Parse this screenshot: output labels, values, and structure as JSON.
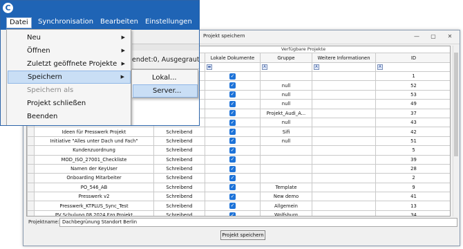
{
  "app": {
    "logo_letter": "C",
    "menu": [
      "Datei",
      "Synchronisation",
      "Bearbeiten",
      "Einstellungen"
    ],
    "status_fragment": "endet:0, Ausgegraut"
  },
  "file_menu": {
    "items": [
      {
        "label": "Neu",
        "submenu": true
      },
      {
        "label": "Öffnen",
        "submenu": true
      },
      {
        "label": "Zuletzt geöffnete Projekte",
        "submenu": true
      },
      {
        "label": "Speichern",
        "submenu": true,
        "highlighted": true
      },
      {
        "label": "Speichern als",
        "disabled": true
      },
      {
        "label": "Projekt schließen"
      },
      {
        "label": "Beenden"
      }
    ],
    "save_submenu": [
      "Lokal...",
      "Server..."
    ],
    "arrow": "▶"
  },
  "dialog": {
    "title": "Projekt speichern",
    "window_buttons": [
      "—",
      "▢",
      "✕"
    ],
    "grid_caption": "Verfügbare Projekte",
    "columns": [
      "",
      "Lokale Dokumente",
      "Gruppe",
      "Weitere Informationen",
      "ID"
    ],
    "rows": [
      {
        "name": "",
        "mode": "",
        "local": true,
        "group": "",
        "info": "",
        "id": "1"
      },
      {
        "name": "",
        "mode": "",
        "local": true,
        "group": "null",
        "info": "",
        "id": "52"
      },
      {
        "name": "",
        "mode": "",
        "local": true,
        "group": "null",
        "info": "",
        "id": "53"
      },
      {
        "name": "",
        "mode": "",
        "local": true,
        "group": "null",
        "info": "",
        "id": "49"
      },
      {
        "name": "",
        "mode": "",
        "local": true,
        "group": "Projekt_Audi_A...",
        "info": "",
        "id": "37"
      },
      {
        "name": "",
        "mode": "",
        "local": true,
        "group": "null",
        "info": "",
        "id": "43"
      },
      {
        "name": "Ideen für Presswerk Projekt",
        "mode": "Schreibend",
        "local": true,
        "group": "Sifi",
        "info": "",
        "id": "42"
      },
      {
        "name": "Initiative \"Alles unter Dach und Fach\"",
        "mode": "Schreibend",
        "local": true,
        "group": "null",
        "info": "",
        "id": "51"
      },
      {
        "name": "Kundenzuordnung",
        "mode": "Schreibend",
        "local": true,
        "group": "",
        "info": "",
        "id": "5"
      },
      {
        "name": "MOD_ISO_27001_Checkliste",
        "mode": "Schreibend",
        "local": true,
        "group": "",
        "info": "",
        "id": "39"
      },
      {
        "name": "Namen der KeyUser",
        "mode": "Schreibend",
        "local": true,
        "group": "",
        "info": "",
        "id": "28"
      },
      {
        "name": "Onboarding Mitarbeiter",
        "mode": "Schreibend",
        "local": true,
        "group": "",
        "info": "",
        "id": "2"
      },
      {
        "name": "PO_546_AB",
        "mode": "Schreibend",
        "local": true,
        "group": "Template",
        "info": "",
        "id": "9"
      },
      {
        "name": "Presswerk v2",
        "mode": "Schreibend",
        "local": true,
        "group": "New demo",
        "info": "",
        "id": "41"
      },
      {
        "name": "Presswerk_KTPLUS_Sync_Test",
        "mode": "Schreibend",
        "local": true,
        "group": "Allgemein",
        "info": "",
        "id": "13"
      },
      {
        "name": "PV Schulung 08 2024 Fzg Projekt",
        "mode": "Schreibend",
        "local": true,
        "group": "Wolfsburg",
        "info": "",
        "id": "34"
      }
    ],
    "name_label": "Projektname:",
    "name_value": "Dachbegrünung Standort Berlin",
    "save_button": "Projekt speichern"
  }
}
